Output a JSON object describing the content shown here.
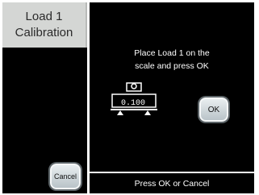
{
  "title": "Load 1\nCalibration",
  "instruction": "Place Load 1 on the\nscale and press OK",
  "scale": {
    "reading": "0.100",
    "icon": "scale-icon"
  },
  "buttons": {
    "ok_label": "OK",
    "cancel_label": "Cancel"
  },
  "status": "Press OK or Cancel",
  "colors": {
    "background": "#000000",
    "title_panel": "#d4d6d4",
    "button_face": "#c9d1d5",
    "text": "#ffffff"
  }
}
